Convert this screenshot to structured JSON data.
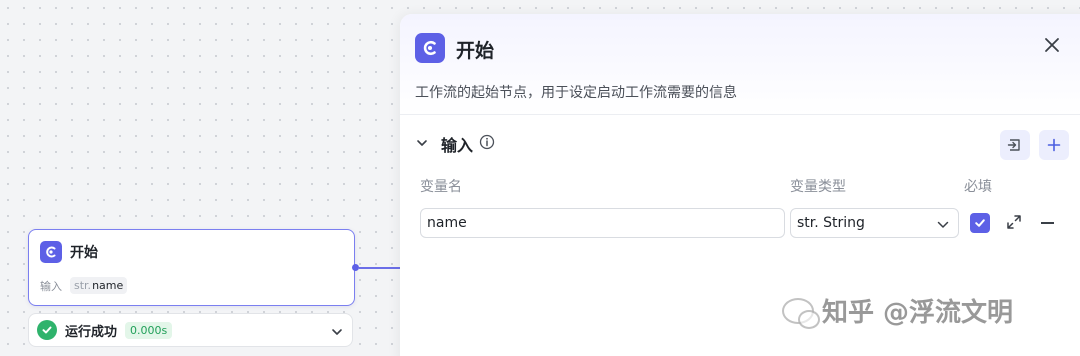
{
  "node": {
    "title": "开始",
    "input_label": "输入",
    "chip_type": "str.",
    "chip_name": "name"
  },
  "run_status": {
    "text": "运行成功",
    "time": "0.000s"
  },
  "panel": {
    "title": "开始",
    "description": "工作流的起始节点，用于设定启动工作流需要的信息",
    "section_title": "输入",
    "columns": {
      "name": "变量名",
      "type": "变量类型",
      "required": "必填"
    },
    "rows": [
      {
        "name": "name",
        "type": "str. String",
        "required": true
      }
    ]
  },
  "watermark": {
    "text": "知乎 @浮流文明"
  },
  "colors": {
    "accent": "#5d60e6",
    "success": "#2fb36c"
  },
  "icons": [
    "start-node-icon",
    "close-icon",
    "chevron-down-icon",
    "info-icon",
    "import-icon",
    "plus-icon",
    "check-icon",
    "expand-icon",
    "minus-icon",
    "success-check-icon"
  ]
}
